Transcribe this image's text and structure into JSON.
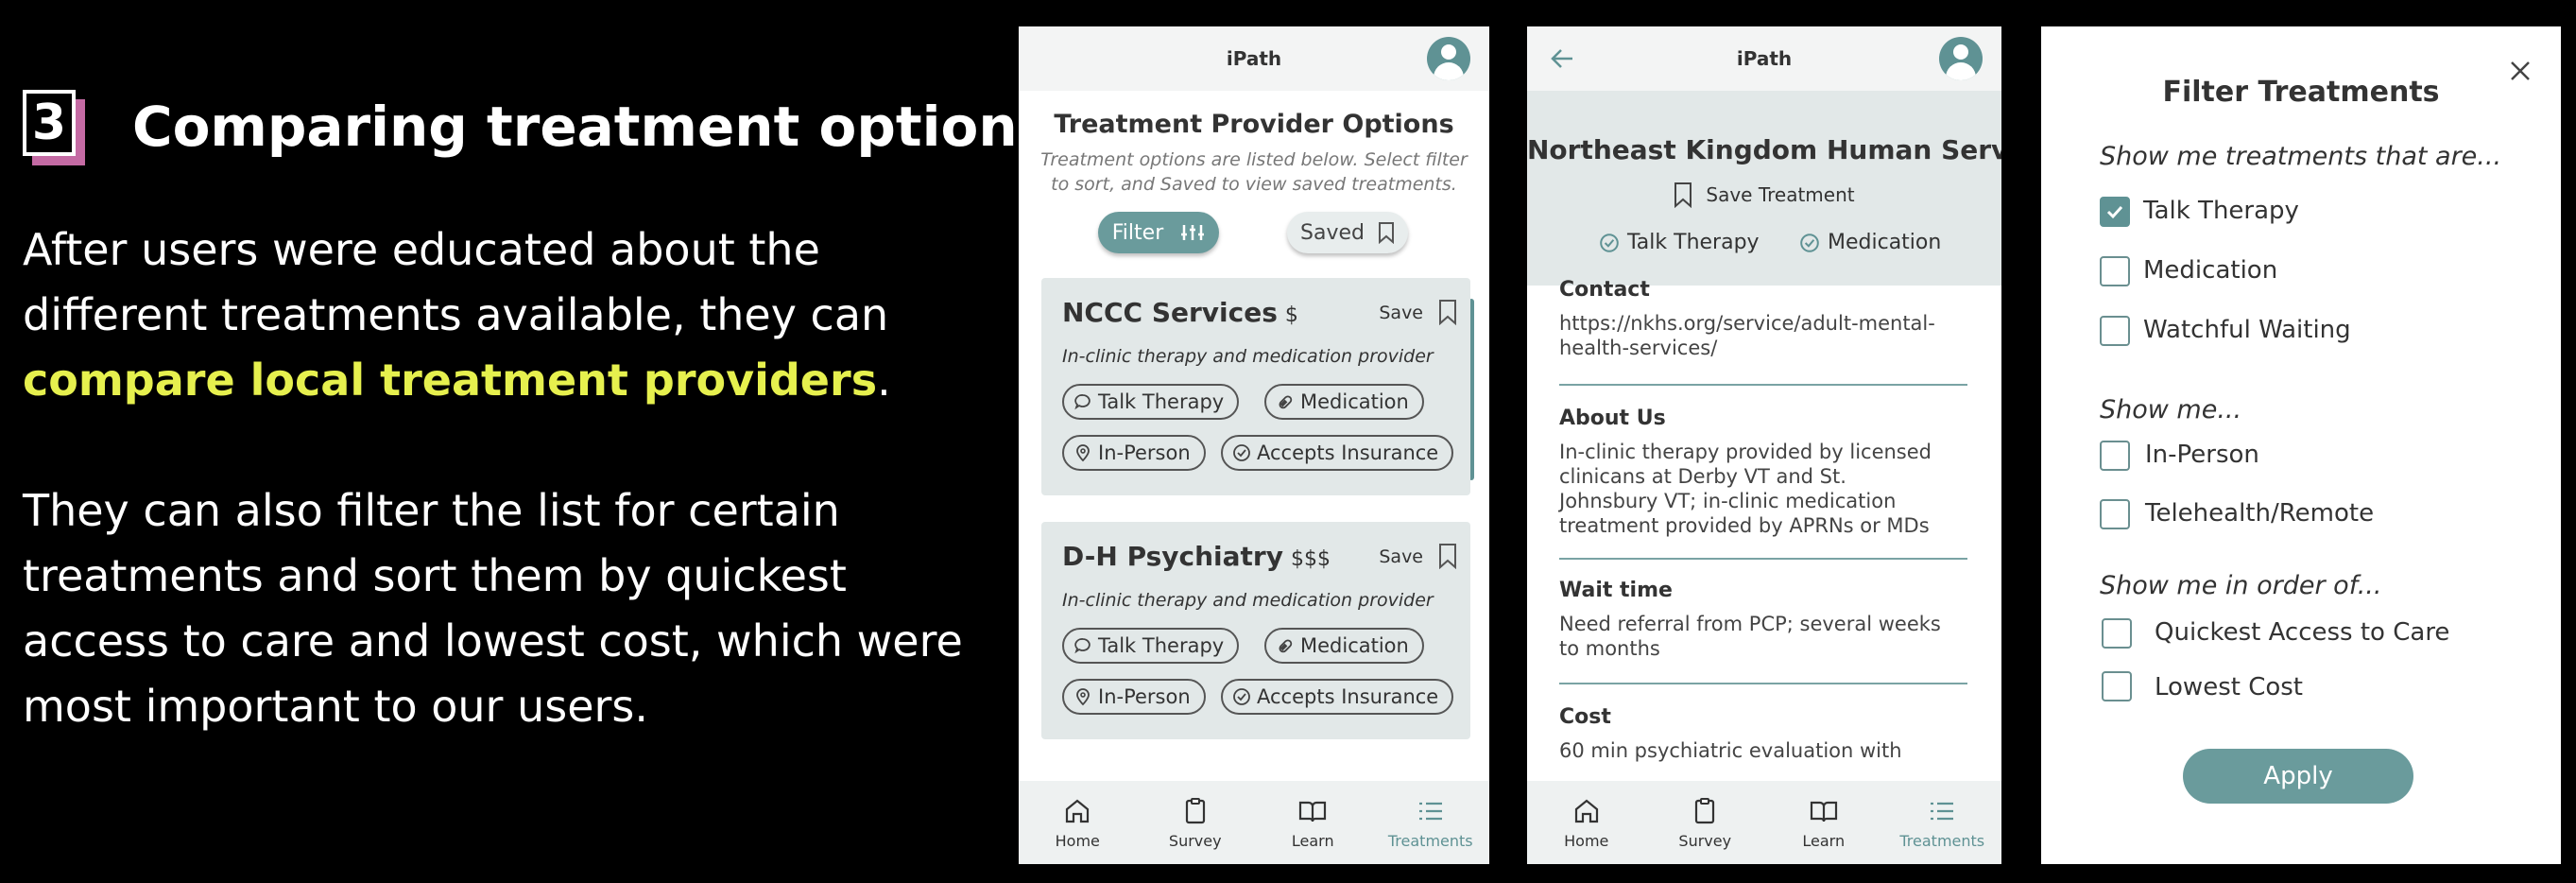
{
  "step_number": "3",
  "headline": "Comparing treatment options",
  "paragraph1_part1": "After users were educated about the different treatments available, they can",
  "paragraph1_highlight": "compare local treatment providers",
  "paragraph1_end": ".",
  "paragraph2": "They can also filter the list for certain treatments and sort them by quickest access to care and lowest cost, which were most important to our users.",
  "app_name": "iPath",
  "nav": [
    {
      "label": "Home",
      "icon": "home-icon"
    },
    {
      "label": "Survey",
      "icon": "clipboard-icon"
    },
    {
      "label": "Learn",
      "icon": "book-icon"
    },
    {
      "label": "Treatments",
      "icon": "list-icon"
    }
  ],
  "screen1": {
    "title": "Treatment Provider Options",
    "subtitle_line1": "Treatment options are listed below. Select filter",
    "subtitle_line2": "to sort, and Saved to view saved treatments.",
    "filter_label": "Filter",
    "saved_label": "Saved",
    "providers": [
      {
        "name": "NCCC Services",
        "price": "$",
        "save": "Save",
        "desc": "In-clinic therapy and medication provider",
        "tags": [
          "Talk Therapy",
          "Medication",
          "In-Person",
          "Accepts Insurance"
        ]
      },
      {
        "name": "D-H Psychiatry",
        "price": "$$$",
        "save": "Save",
        "desc": "In-clinic therapy and medication provider",
        "tags": [
          "Talk Therapy",
          "Medication",
          "In-Person",
          "Accepts Insurance"
        ]
      }
    ]
  },
  "screen2": {
    "title": "Northeast Kingdom Human Services",
    "save_treatment": "Save Treatment",
    "tags": [
      "Talk Therapy",
      "Medication"
    ],
    "contact_label": "Contact",
    "contact_line1": "https://nkhs.org/service/adult-mental-",
    "contact_line2": "health-services/",
    "about_label": "About Us",
    "about_lines": [
      "In-clinic therapy provided by licensed",
      "clinicans at Derby VT and St.",
      "Johnsbury VT; in-clinic medication",
      "treatment provided by APRNs or MDs"
    ],
    "wait_label": "Wait time",
    "wait_lines": [
      "Need referral from PCP; several weeks",
      "to months"
    ],
    "cost_label": "Cost",
    "cost_line": "60 min psychiatric evaluation with"
  },
  "screen3": {
    "title": "Filter Treatments",
    "group1_heading": "Show me treatments that are...",
    "group1": [
      {
        "label": "Talk Therapy",
        "checked": true
      },
      {
        "label": "Medication",
        "checked": false
      },
      {
        "label": "Watchful Waiting",
        "checked": false
      }
    ],
    "group2_heading": "Show me...",
    "group2": [
      {
        "label": "In-Person",
        "checked": false
      },
      {
        "label": "Telehealth/Remote",
        "checked": false
      }
    ],
    "group3_heading": "Show me in order of...",
    "group3": [
      {
        "label": "Quickest Access to Care",
        "checked": false
      },
      {
        "label": "Lowest Cost",
        "checked": false
      }
    ],
    "apply_label": "Apply"
  },
  "colors": {
    "accent": "#5f9294",
    "highlight": "#e6f04e",
    "step_shadow": "#c46aa3",
    "card_bg": "#e2e8e8"
  }
}
